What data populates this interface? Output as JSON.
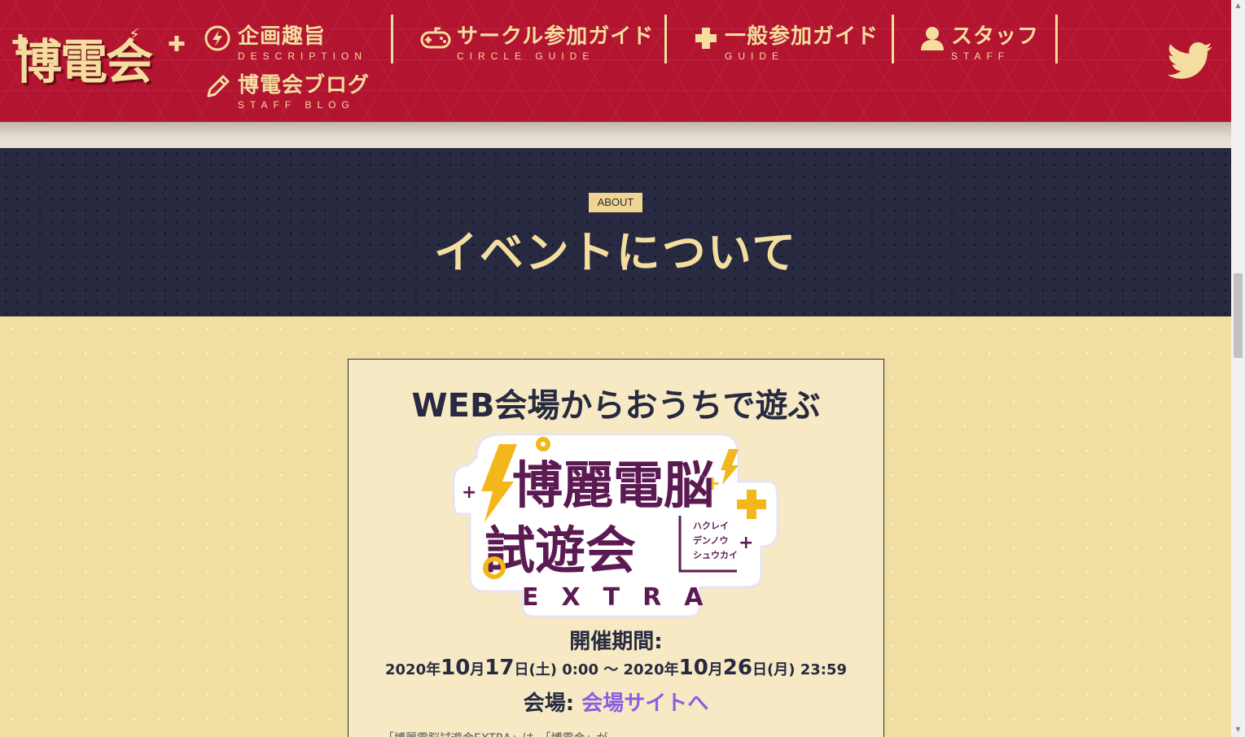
{
  "header": {
    "logo_text": "博電会",
    "nav": [
      {
        "label": "企画趣旨",
        "sub": "DESCRIPTION",
        "icon": "lightning-circle-icon"
      },
      {
        "label": "サークル参加ガイド",
        "sub": "CIRCLE GUIDE",
        "icon": "gamepad-icon"
      },
      {
        "label": "一般参加ガイド",
        "sub": "GUIDE",
        "icon": "plus-cross-icon"
      },
      {
        "label": "スタッフ",
        "sub": "STAFF",
        "icon": "person-icon"
      },
      {
        "label": "博電会ブログ",
        "sub": "STAFF BLOG",
        "icon": "pencil-icon"
      }
    ],
    "social_icon": "twitter-icon"
  },
  "about": {
    "badge": "ABOUT",
    "title": "イベントについて"
  },
  "card": {
    "title": "WEB会場からおうちで遊ぶ",
    "event_logo": {
      "line1": "博麗電脳",
      "line2": "試遊会",
      "line3": "EXTRA",
      "ruby": [
        "ハクレイ",
        "デンノウ",
        "シュウカイ"
      ]
    },
    "period_label": "開催期間:",
    "period": {
      "start_year": "2020年",
      "start_month": "10",
      "month_unit": "月",
      "start_day": "17",
      "start_suffix": "日(土) 0:00 〜 2020年",
      "end_month": "10",
      "end_day": "26",
      "end_suffix": "日(月) 23:59"
    },
    "venue_label": "会場: ",
    "venue_link": "会場サイトへ",
    "cut_text": "「博麗電脳試遊会EXTRA」は、「博電会」が…"
  },
  "colors": {
    "header_red": "#b3142f",
    "accent_cream": "#f3dd9f",
    "navy": "#272a40",
    "beige": "#f0dea3",
    "link_purple": "#8b5fe0"
  }
}
